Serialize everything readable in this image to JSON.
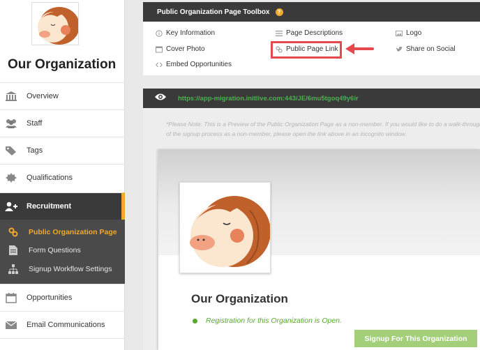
{
  "sidebar": {
    "org_name": "Our Organization",
    "items": [
      {
        "label": "Overview",
        "icon": "bank-icon"
      },
      {
        "label": "Staff",
        "icon": "users-icon"
      },
      {
        "label": "Tags",
        "icon": "tags-icon"
      },
      {
        "label": "Qualifications",
        "icon": "certificate-icon"
      },
      {
        "label": "Recruitment",
        "icon": "user-plus-icon"
      },
      {
        "label": "Opportunities",
        "icon": "calendar-icon"
      },
      {
        "label": "Email Communications",
        "icon": "envelope-icon"
      }
    ],
    "subitems": [
      {
        "label": "Public Organization Page",
        "icon": "link-icon"
      },
      {
        "label": "Form Questions",
        "icon": "document-icon"
      },
      {
        "label": "Signup Workflow Settings",
        "icon": "sitemap-icon"
      }
    ]
  },
  "toolbox": {
    "title": "Public Organization Page Toolbox",
    "help": "?",
    "links": {
      "key_info": "Key Information",
      "page_desc": "Page Descriptions",
      "logo": "Logo",
      "cover_photo": "Cover Photo",
      "public_link": "Public Page Link",
      "share": "Share on Social",
      "embed": "Embed Opportunities"
    }
  },
  "preview": {
    "url": "https://app-migration.initlive.com:443/JE/6mu5tgoq49y6ir",
    "note": "*Please Note: This is a Preview of the Public Organization Page as a non-member. If you would like to do a walk-through of the signup process as a non-member, please open the link above in an incognito window.",
    "org_title": "Our Organization",
    "status": "Registration for this Organization is Open.",
    "signup_button": "Signup For This Organization"
  },
  "colors": {
    "accent": "#f0a830",
    "dark": "#3a3a3a",
    "highlight": "#e5484d",
    "green": "#5aa630",
    "button": "#a3cf7a"
  }
}
